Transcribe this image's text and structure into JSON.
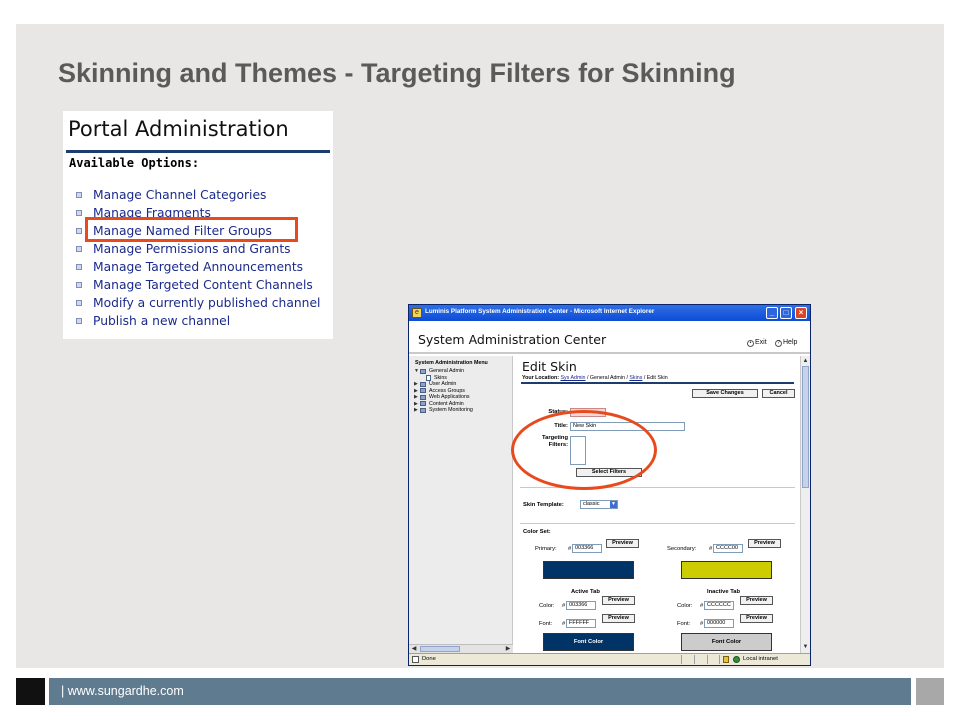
{
  "slide": {
    "title": "Skinning and Themes - Targeting Filters for Skinning",
    "footer_text": "| www.sungardhe.com"
  },
  "portal": {
    "title": "Portal Administration",
    "subtitle": "Available Options:",
    "options": [
      "Manage Channel Categories",
      "Manage Fragments",
      "Manage Named Filter Groups",
      "Manage Permissions and Grants",
      "Manage Targeted Announcements",
      "Manage Targeted Content Channels",
      "Modify a currently published channel",
      "Publish a new channel"
    ],
    "highlighted_option": "Manage Named Filter Groups"
  },
  "window": {
    "title": "Luminis Platform System Administration Center - Microsoft Internet Explorer",
    "controls": {
      "minimize": "_",
      "maximize": "□",
      "close": "×"
    },
    "app_title": "System Administration Center",
    "exit_label": "Exit",
    "help_label": "Help",
    "menu_title": "System Administration Menu",
    "menu_items": [
      {
        "label": "General Admin",
        "expanded": true
      },
      {
        "label": "Skins",
        "child": true
      },
      {
        "label": "User Admin"
      },
      {
        "label": "Access Groups"
      },
      {
        "label": "Web Applications"
      },
      {
        "label": "Content Admin"
      },
      {
        "label": "System Monitoring"
      }
    ],
    "page_title": "Edit Skin",
    "location_label": "Your Location:",
    "breadcrumb": [
      "Sys Admin",
      "General Admin",
      "Skins",
      "Edit Skin"
    ],
    "save_button": "Save Changes",
    "cancel_button": "Cancel",
    "status_label": "Status:",
    "title_label": "Title:",
    "title_value": "New Skin",
    "targeting_label_1": "Targeting",
    "targeting_label_2": "Filters:",
    "select_filters_button": "Select Filters",
    "skin_template_label": "Skin Template:",
    "skin_template_value": "classic",
    "color_set_label": "Color Set:",
    "primary_label": "Primary:",
    "primary_value": "003366",
    "secondary_label": "Secondary:",
    "secondary_value": "CCCC00",
    "preview_label": "Preview",
    "hash": "#",
    "active_tab_label": "Active Tab",
    "inactive_tab_label": "Inactive Tab",
    "color_label": "Color:",
    "font_label": "Font:",
    "active_color_value": "003366",
    "active_font_value": "FFFFFF",
    "inactive_color_value": "CCCCCC",
    "inactive_font_value": "000000",
    "font_color_label": "Font Color",
    "status_done": "Done",
    "status_zone": "Local intranet"
  },
  "colors": {
    "primary": "#003366",
    "secondary": "#CCCC00",
    "active_color": "#003366",
    "active_font": "#FFFFFF",
    "inactive_color": "#CCCCCC",
    "inactive_font": "#000000",
    "highlight": "#E84A1C"
  }
}
